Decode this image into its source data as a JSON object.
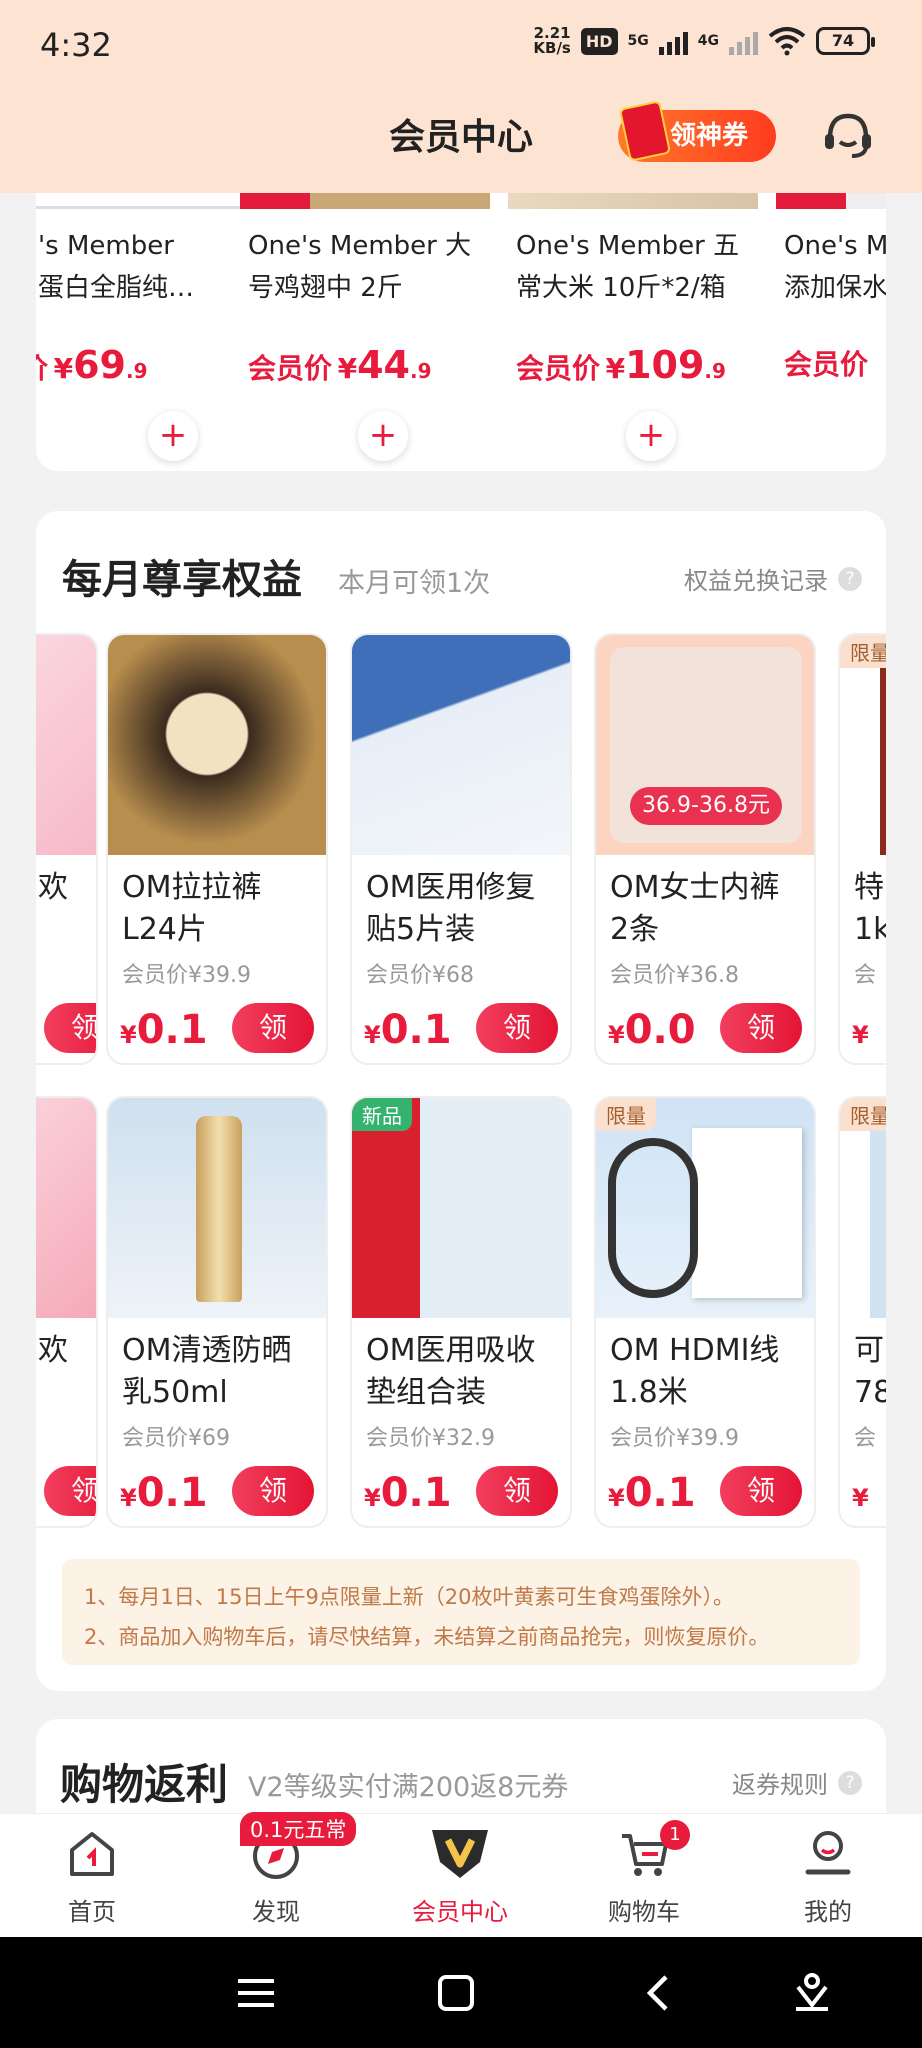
{
  "status": {
    "time": "4:32",
    "speed_top": "2.21",
    "speed_bottom": "KB/s",
    "hd": "HD",
    "net1": "5G",
    "net2": "4G",
    "battery": "74"
  },
  "header": {
    "title": "会员中心",
    "coupon": "领神券"
  },
  "products": [
    {
      "name": "'s Member\n蛋白全脂纯…",
      "label": "会员价",
      "yen": "¥",
      "big": "69",
      "small": ".9",
      "label_shown": "价"
    },
    {
      "name": "One's Member 大\n号鸡翅中 2斤",
      "label": "会员价",
      "yen": "¥",
      "big": "44",
      "small": ".9"
    },
    {
      "name": "One's Member 五\n常大米 10斤*2/箱",
      "label": "会员价",
      "yen": "¥",
      "big": "109",
      "small": ".9"
    },
    {
      "name": "One's M\n添加保水",
      "label": "会员价",
      "yen": "",
      "big": "",
      "small": ""
    }
  ],
  "monthly": {
    "title": "每月尊享权益",
    "subtitle": "本月可领1次",
    "record": "权益兑换记录",
    "help": "?",
    "row1": [
      {
        "name": "",
        "member_price": "",
        "yen": "",
        "price": "",
        "btn": "领",
        "tag": ""
      },
      {
        "name": "OM拉拉裤\nL24片",
        "member_price": "会员价¥39.9",
        "yen": "¥",
        "price": "0.1",
        "btn": "领",
        "tag": ""
      },
      {
        "name": "OM医用修复\n贴5片装",
        "member_price": "会员价¥68",
        "yen": "¥",
        "price": "0.1",
        "btn": "领",
        "tag": ""
      },
      {
        "name": "OM女士内裤\n2条",
        "member_price": "会员价¥36.8",
        "yen": "¥",
        "price": "0.0",
        "btn": "领",
        "tag": "",
        "overlay": "36.9-36.8元"
      },
      {
        "name": "特\n1k",
        "member_price": "会",
        "yen": "¥",
        "price": "",
        "btn": "",
        "tag": "限量"
      }
    ],
    "row2": [
      {
        "name": "",
        "member_price": "",
        "yen": "",
        "price": "",
        "btn": "领",
        "tag": ""
      },
      {
        "name": "OM清透防晒\n乳50ml",
        "member_price": "会员价¥69",
        "yen": "¥",
        "price": "0.1",
        "btn": "领",
        "tag": ""
      },
      {
        "name": "OM医用吸收\n垫组合装",
        "member_price": "会员价¥32.9",
        "yen": "¥",
        "price": "0.1",
        "btn": "领",
        "tag": "新品"
      },
      {
        "name": "OM HDMI线\n1.8米",
        "member_price": "会员价¥39.9",
        "yen": "¥",
        "price": "0.1",
        "btn": "领",
        "tag": "限量"
      },
      {
        "name": "可\n78",
        "member_price": "会",
        "yen": "¥",
        "price": "",
        "btn": "",
        "tag": "限量"
      }
    ],
    "side_text": "欢",
    "notes": [
      "1、每月1日、15日上午9点限量上新（20枚叶黄素可生食鸡蛋除外）。",
      "2、商品加入购物车后，请尽快结算，未结算之前商品抢完，则恢复原价。"
    ]
  },
  "rebate": {
    "title": "购物返利",
    "subtitle": "V2等级实付满200返8元券",
    "rules": "返券规则",
    "help": "?"
  },
  "nav": [
    {
      "label": "首页"
    },
    {
      "label": "发现",
      "badge": "0.1元五常"
    },
    {
      "label": "会员中心"
    },
    {
      "label": "购物车",
      "badge": "1"
    },
    {
      "label": "我的"
    }
  ],
  "colors": {
    "accent": "#e81b3c",
    "header_bg": "#fce3d2"
  }
}
